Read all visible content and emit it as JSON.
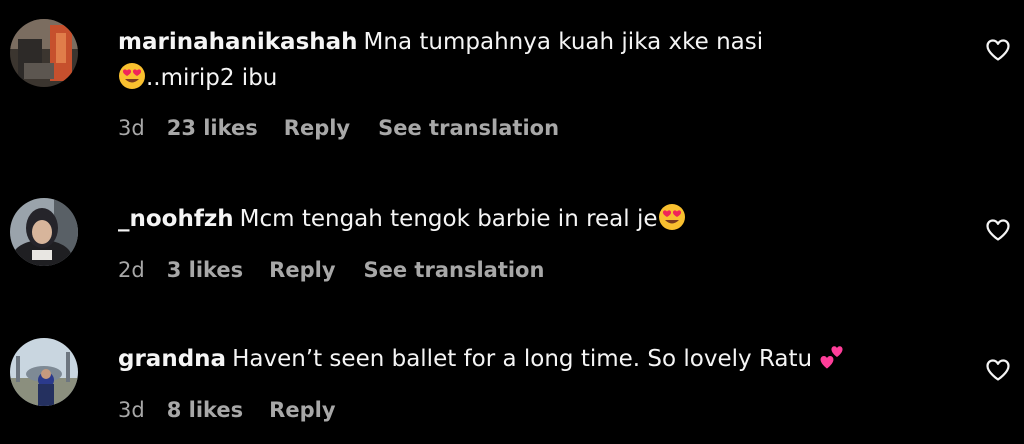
{
  "comments": [
    {
      "username": "marinahanikashah",
      "text_before_emoji": "Mna tumpahnya kuah jika xke nasi",
      "text_after_emoji": "..mirip2 ibu",
      "emoji": "smiling-face-with-heart-eyes",
      "time": "3d",
      "likes": "23 likes",
      "reply": "Reply",
      "translate": "See translation"
    },
    {
      "username": "_noohfzh",
      "text_before_emoji": "Mcm tengah tengok barbie in real je",
      "emoji": "smiling-face-with-heart-eyes",
      "time": "2d",
      "likes": "3 likes",
      "reply": "Reply",
      "translate": "See translation"
    },
    {
      "username": "grandna",
      "text_before_emoji": "Haven’t seen ballet for a long time. So lovely Ratu",
      "emoji": "two-hearts",
      "time": "3d",
      "likes": "8 likes",
      "reply": "Reply"
    }
  ],
  "colors": {
    "background": "#000000",
    "primary_text": "#f5f5f5",
    "secondary_text": "#a8a8a8",
    "heart_emoji": "#ff3e9a"
  },
  "icons": {
    "like": "heart-outline-icon"
  }
}
